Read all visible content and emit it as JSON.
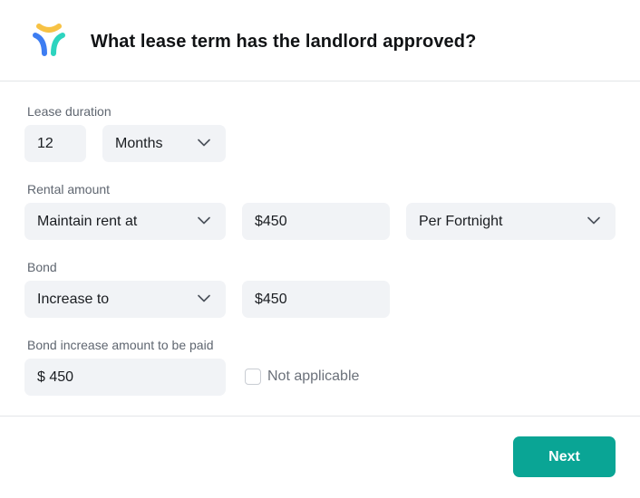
{
  "header": {
    "title": "What lease term has the landlord approved?",
    "logo_colors": {
      "yellow": "#f7c244",
      "blue": "#3d7df2",
      "teal": "#2dd4bf"
    }
  },
  "lease_duration": {
    "label": "Lease duration",
    "value": "12",
    "unit": "Months"
  },
  "rental_amount": {
    "label": "Rental amount",
    "mode": "Maintain rent at",
    "amount": "$450",
    "frequency": "Per Fortnight"
  },
  "bond": {
    "label": "Bond",
    "mode": "Increase to",
    "amount": "$450"
  },
  "bond_increase": {
    "label": "Bond increase amount to be paid",
    "amount": "$ 450",
    "not_applicable_label": "Not applicable",
    "not_applicable_checked": false
  },
  "footer": {
    "next_label": "Next",
    "accent_color": "#0aa595"
  }
}
